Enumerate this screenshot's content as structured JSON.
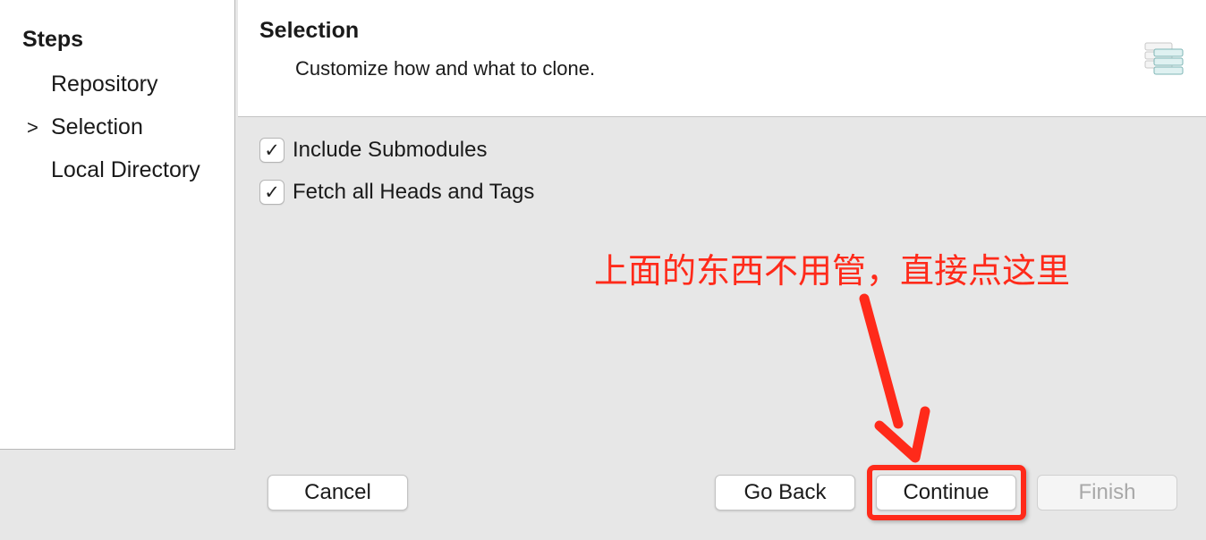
{
  "sidebar": {
    "title": "Steps",
    "current_marker": ">",
    "items": [
      {
        "label": "Repository"
      },
      {
        "label": "Selection"
      },
      {
        "label": "Local Directory"
      }
    ]
  },
  "header": {
    "title": "Selection",
    "description": "Customize how and what to clone.",
    "icon": "wizard-banner-icon"
  },
  "options": [
    {
      "label": "Include Submodules",
      "checked": true,
      "check_glyph": "✓"
    },
    {
      "label": "Fetch all Heads and Tags",
      "checked": true,
      "check_glyph": "✓"
    }
  ],
  "buttons": {
    "cancel": "Cancel",
    "back": "Go Back",
    "continue": "Continue",
    "finish": "Finish"
  },
  "annotation": {
    "text": "上面的东西不用管，直接点这里",
    "color": "#ff2a1a"
  },
  "colors": {
    "background": "#e7e7e7",
    "panel": "#ffffff",
    "disabled_text": "#a8a8a8"
  }
}
